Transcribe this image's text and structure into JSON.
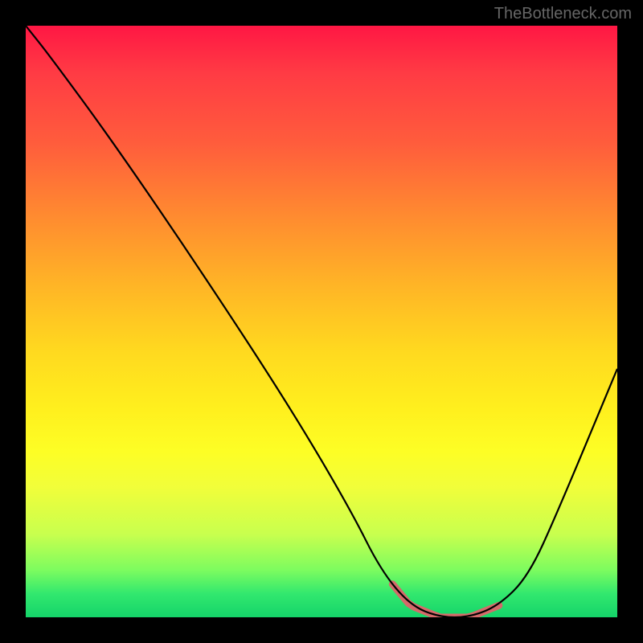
{
  "watermark": "TheBottleneck.com",
  "chart_data": {
    "type": "line",
    "title": "",
    "xlabel": "",
    "ylabel": "",
    "xlim": [
      0,
      100
    ],
    "ylim": [
      0,
      100
    ],
    "grid": false,
    "legend": false,
    "background": "rainbow-vertical-gradient",
    "series": [
      {
        "name": "bottleneck-curve",
        "x": [
          0,
          4,
          15,
          30,
          45,
          55,
          60,
          65,
          70,
          75,
          80,
          85,
          90,
          100
        ],
        "values": [
          100,
          95,
          80,
          58,
          35,
          18,
          8,
          2,
          0,
          0,
          2,
          7,
          18,
          42
        ]
      }
    ],
    "annotations": [
      {
        "name": "optimal-range-highlight",
        "type": "segment",
        "color": "#d46a6a",
        "x_start": 62,
        "x_end": 80,
        "y": 0
      }
    ]
  }
}
